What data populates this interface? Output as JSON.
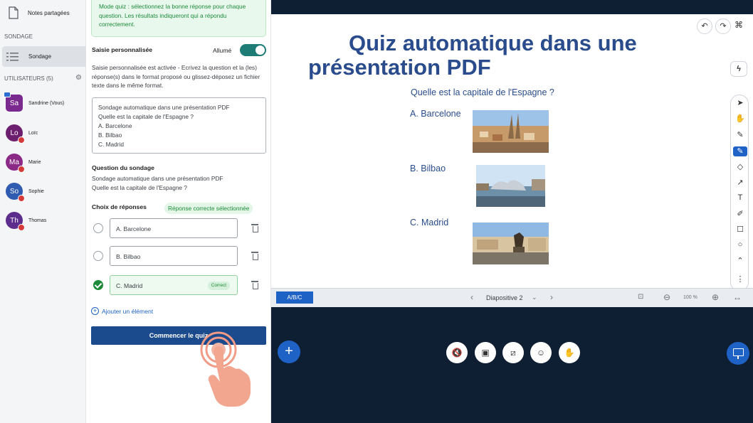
{
  "sidebar": {
    "shared_notes_label": "Notes partagées",
    "poll_section_title": "SONDAGE",
    "poll_item_label": "Sondage",
    "users_section_title": "UTILISATEURS (5)",
    "users": [
      {
        "initials": "Sa",
        "name": "Sandrine (Vous)",
        "color": "#7a2a8f"
      },
      {
        "initials": "Lo",
        "name": "Loïc",
        "color": "#6b1f6e"
      },
      {
        "initials": "Ma",
        "name": "Marie",
        "color": "#8a2a86"
      },
      {
        "initials": "So",
        "name": "Sophie",
        "color": "#2f5bb0"
      },
      {
        "initials": "Th",
        "name": "Thomas",
        "color": "#5c2d8c"
      }
    ]
  },
  "panel": {
    "quiz_note": "Mode quiz : sélectionnez la bonne réponse pour chaque question. Les résultats indiqueront qui a répondu correctement.",
    "custom_input_title": "Saisie personnalisée",
    "toggle_label": "Allumé",
    "toggle_on": true,
    "custom_input_desc": "Saisie personnalisée est activée - Ecrivez la question et la (les) réponse(s) dans le format proposé ou glissez-déposez un fichier texte dans le même format.",
    "textarea_value": "Sondage automatique dans une présentation PDF\nQuelle est la capitale de l'Espagne ?\nA. Barcelone\nB. Bilbao\nC. Madrid",
    "question_title": "Question du sondage",
    "question_text": "Sondage automatique dans une présentation PDF\nQuelle est la capitale de l'Espagne ?",
    "answers_title": "Choix de réponses",
    "correct_badge": "Réponse correcte sélectionnée",
    "answers": [
      {
        "label": "A. Barcelone",
        "correct": false
      },
      {
        "label": "B. Bilbao",
        "correct": false
      },
      {
        "label": "C. Madrid",
        "correct": true
      }
    ],
    "correct_tag": "Correct",
    "add_item_label": "Ajouter un élément",
    "start_button_label": "Commencer le quiz"
  },
  "slide": {
    "title": "Quiz automatique dans une présentation PDF",
    "question": "Quelle est la capitale de l'Espagne ?",
    "options": [
      "A.  Barcelone",
      "B. Bilbao",
      "C. Madrid"
    ]
  },
  "slide_bar": {
    "abc_label": "A/B/C",
    "slide_label": "Diapositive 2",
    "zoom": "100 %"
  },
  "colors": {
    "accent": "#1f62c6",
    "title_blue": "#2a4c8c",
    "success": "#1d8a3a",
    "stage_bg": "#0f1f33"
  }
}
